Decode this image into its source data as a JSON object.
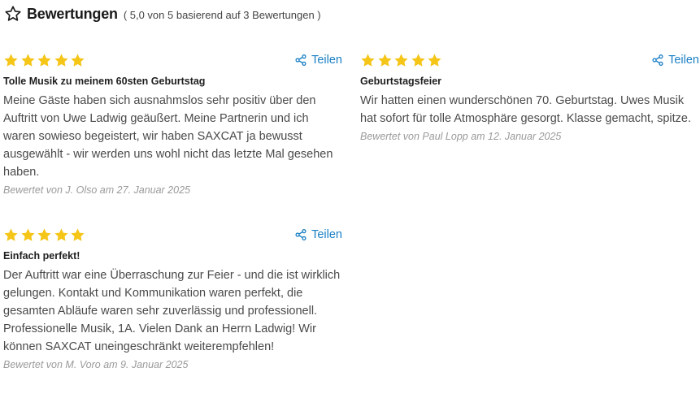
{
  "header": {
    "title": "Bewertungen",
    "summary": "( 5,0 von 5 basierend auf 3 Bewertungen )"
  },
  "colors": {
    "star": "#f5c518",
    "link": "#1a7fc4"
  },
  "reviews": [
    {
      "rating": 5,
      "share_label": "Teilen",
      "title": "Tolle Musik zu meinem 60sten Geburtstag",
      "text": "Meine Gäste haben sich ausnahmslos sehr positiv über den Auftritt von Uwe Ladwig geäußert. Meine Partnerin und ich waren sowieso begeistert, wir haben SAXCAT ja bewusst ausgewählt - wir werden uns wohl nicht das letzte Mal gesehen haben.",
      "meta": "Bewertet von J. Olso am 27. Januar 2025"
    },
    {
      "rating": 5,
      "share_label": "Teilen",
      "title": "Geburtstagsfeier",
      "text": "Wir hatten einen wunderschönen 70. Geburtstag. Uwes Musik hat sofort für tolle Atmosphäre gesorgt. Klasse gemacht, spitze.",
      "meta": "Bewertet von Paul Lopp am 12. Januar 2025"
    },
    {
      "rating": 5,
      "share_label": "Teilen",
      "title": "Einfach perfekt!",
      "text": "Der Auftritt war eine Überraschung zur Feier - und die ist wirklich gelungen. Kontakt und Kommunikation waren perfekt, die gesamten Abläufe waren sehr zuverlässig und professionell. Professionelle Musik, 1A. Vielen Dank an Herrn Ladwig! Wir können SAXCAT uneingeschränkt weiterempfehlen!",
      "meta": "Bewertet von M. Voro am 9. Januar 2025"
    }
  ]
}
